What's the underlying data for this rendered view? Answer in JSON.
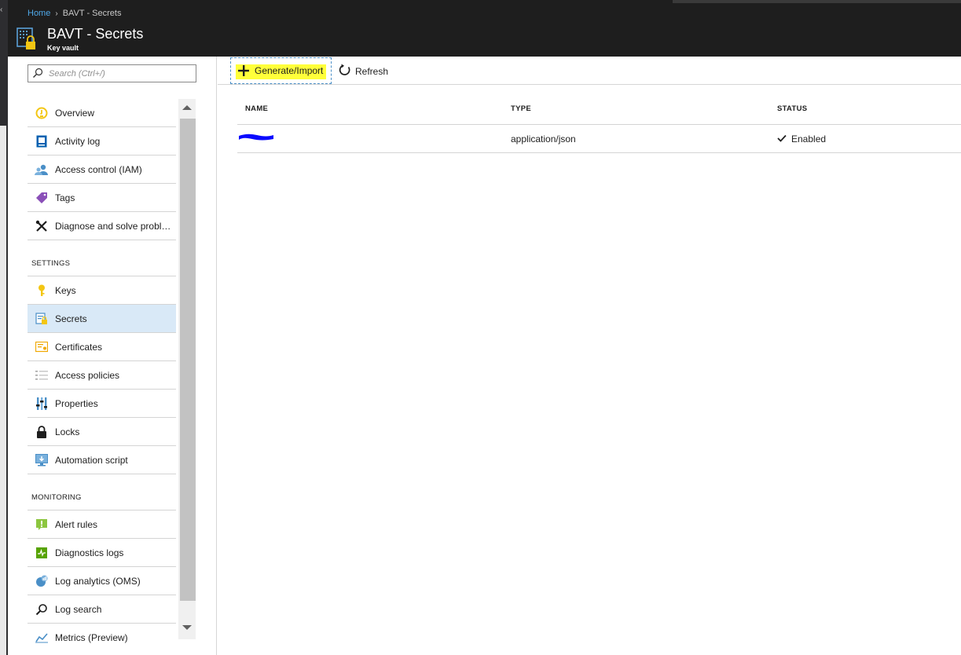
{
  "breadcrumb": {
    "home": "Home",
    "separator": "›",
    "current": "BAVT - Secrets"
  },
  "header": {
    "title": "BAVT - Secrets",
    "subtitle": "Key vault"
  },
  "search": {
    "placeholder": "Search (Ctrl+/)"
  },
  "sidebar": {
    "items": [
      {
        "label": "Overview",
        "icon": "overview-icon"
      },
      {
        "label": "Activity log",
        "icon": "activity-log-icon"
      },
      {
        "label": "Access control (IAM)",
        "icon": "access-control-icon"
      },
      {
        "label": "Tags",
        "icon": "tag-icon"
      },
      {
        "label": "Diagnose and solve proble...",
        "icon": "wrench-icon"
      }
    ],
    "settings_title": "SETTINGS",
    "settings_items": [
      {
        "label": "Keys",
        "icon": "key-icon"
      },
      {
        "label": "Secrets",
        "icon": "secret-icon",
        "selected": true
      },
      {
        "label": "Certificates",
        "icon": "certificate-icon"
      },
      {
        "label": "Access policies",
        "icon": "access-policies-icon"
      },
      {
        "label": "Properties",
        "icon": "properties-icon"
      },
      {
        "label": "Locks",
        "icon": "lock-icon"
      },
      {
        "label": "Automation script",
        "icon": "automation-script-icon"
      }
    ],
    "monitoring_title": "MONITORING",
    "monitoring_items": [
      {
        "label": "Alert rules",
        "icon": "alert-icon"
      },
      {
        "label": "Diagnostics logs",
        "icon": "diagnostics-icon"
      },
      {
        "label": "Log analytics (OMS)",
        "icon": "log-analytics-icon"
      },
      {
        "label": "Log search",
        "icon": "search-icon"
      },
      {
        "label": "Metrics (Preview)",
        "icon": "metrics-icon"
      }
    ]
  },
  "toolbar": {
    "generate_label": "Generate/Import",
    "refresh_label": "Refresh"
  },
  "table": {
    "columns": [
      "NAME",
      "TYPE",
      "STATUS"
    ],
    "rows": [
      {
        "name": "",
        "type": "application/json",
        "status": "Enabled"
      }
    ]
  },
  "colors": {
    "accent": "#0078d4",
    "header_bg": "#1e1e1e",
    "highlight": "#ffff3a",
    "selected_bg": "#d9e9f7",
    "redaction": "#0a0aff"
  }
}
